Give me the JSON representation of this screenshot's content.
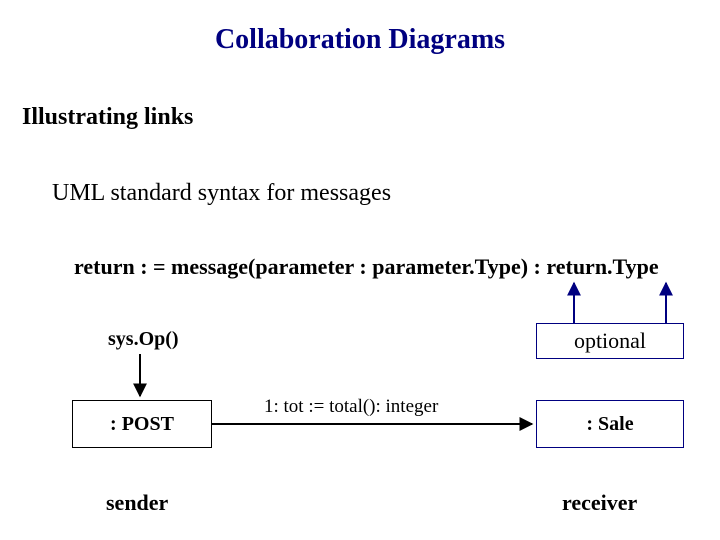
{
  "title": "Collaboration Diagrams",
  "subtitle1": "Illustrating links",
  "subtitle2": "UML standard syntax for messages",
  "syntax_line": "return : = message(parameter : parameter.Type) : return.Type",
  "sysop": "sys.Op()",
  "optional_label": "optional",
  "post_label": ": POST",
  "sale_label": ": Sale",
  "message_label": "1: tot := total(): integer",
  "sender_label": "sender",
  "receiver_label": "receiver"
}
